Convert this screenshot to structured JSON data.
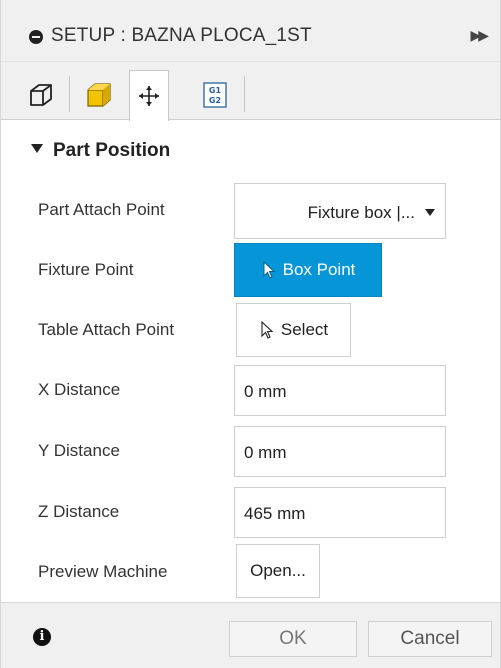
{
  "window": {
    "title": "SETUP : BAZNA PLOCA_1ST",
    "expand_icon": "double-chevron-right-icon"
  },
  "tabs": [
    {
      "icon": "setup-box-outline-icon",
      "active": false
    },
    {
      "icon": "stock-box-yellow-icon",
      "active": false
    },
    {
      "icon": "move-arrows-icon",
      "active": true
    },
    {
      "icon": "g1-g2-code-icon",
      "label": "G1 G2",
      "active": false
    }
  ],
  "colors": {
    "accent": "#0696d7",
    "stock_yellow": "#f2c300"
  },
  "section": {
    "title": "Part Position"
  },
  "rows": {
    "part_attach_point": {
      "label": "Part Attach Point",
      "value": "Fixture box |..."
    },
    "fixture_point": {
      "label": "Fixture Point",
      "button": "Box Point"
    },
    "table_attach_point": {
      "label": "Table Attach Point",
      "button": "Select"
    },
    "x_distance": {
      "label": "X Distance",
      "value": "0 mm"
    },
    "y_distance": {
      "label": "Y Distance",
      "value": "0 mm"
    },
    "z_distance": {
      "label": "Z Distance",
      "value": "465 mm"
    },
    "preview_machine": {
      "label": "Preview Machine",
      "button": "Open..."
    }
  },
  "footer": {
    "ok_label": "OK",
    "cancel_label": "Cancel"
  }
}
